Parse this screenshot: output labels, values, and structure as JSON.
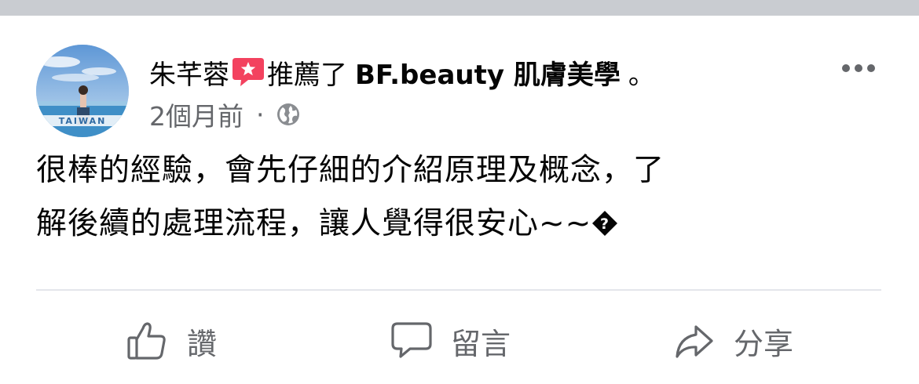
{
  "post": {
    "author": "朱芊蓉",
    "action": "推薦了",
    "page_name": "BF.beauty 肌膚美學",
    "end_punct": "。",
    "time": "2個月前",
    "separator": "·",
    "body_line1": "很棒的經驗，會先仔細的介紹原理及概念，了",
    "body_line2": "解後續的處理流程，讓人覺得很安心~~",
    "avatar_text": "TAIWAN"
  },
  "actions": {
    "like": "讚",
    "comment": "留言",
    "share": "分享"
  },
  "icons": {
    "recommend": "recommend-icon",
    "globe": "globe-icon",
    "more": "more-options-icon",
    "like": "thumbs-up-icon",
    "comment": "speech-bubble-icon",
    "share": "share-arrow-icon",
    "emoji": "unknown-emoji-icon"
  },
  "colors": {
    "text": "#050505",
    "secondary": "#65676b",
    "recommend": "#f3425f",
    "divider": "#e4e6eb",
    "top_bar": "#c9ccd1"
  }
}
